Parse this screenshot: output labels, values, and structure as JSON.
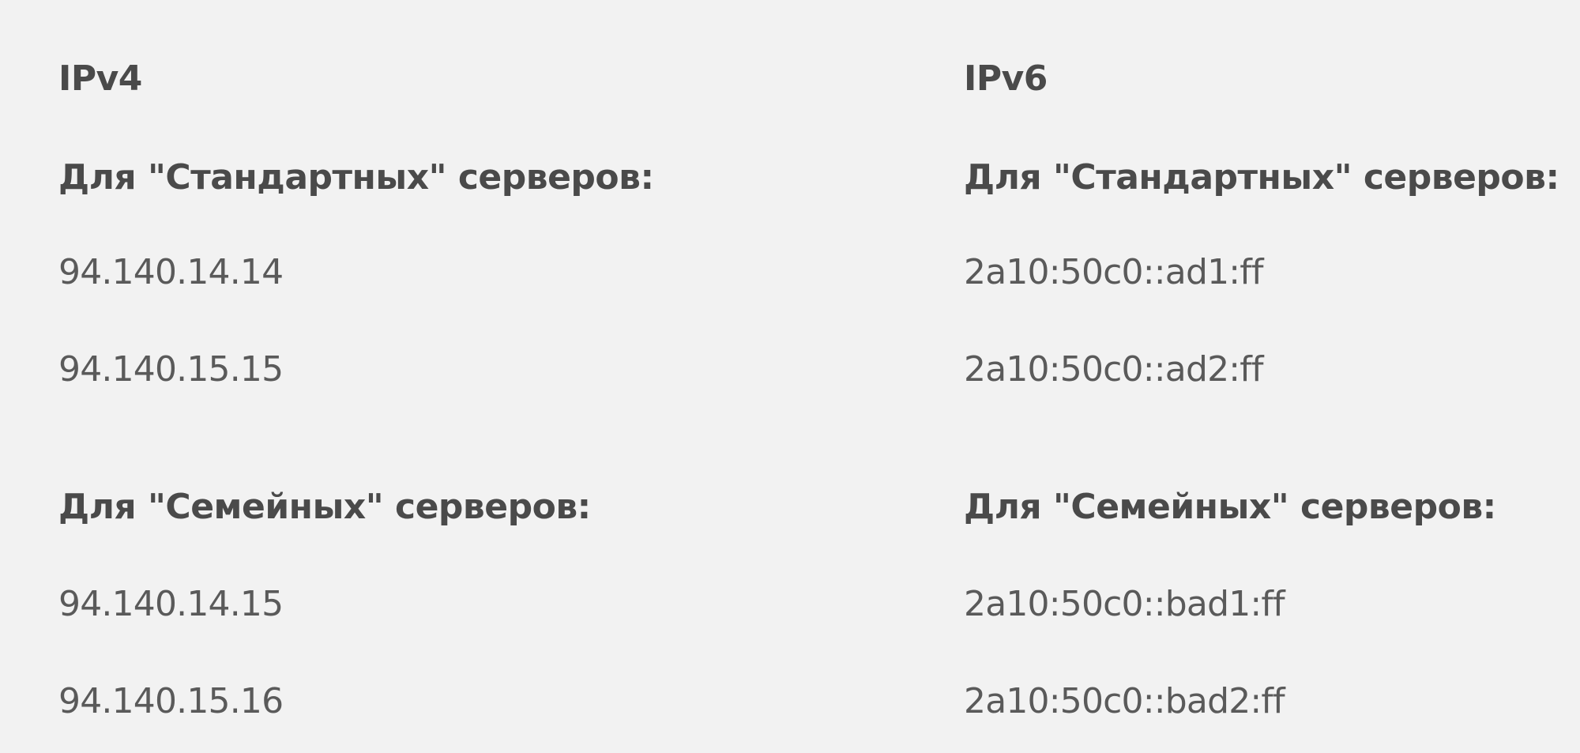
{
  "ipv4": {
    "title": "IPv4",
    "standard": {
      "label": "Для \"Стандартных\" серверов:",
      "addresses": [
        "94.140.14.14",
        "94.140.15.15"
      ]
    },
    "family": {
      "label": "Для \"Семейных\" серверов:",
      "addresses": [
        "94.140.14.15",
        "94.140.15.16"
      ]
    }
  },
  "ipv6": {
    "title": "IPv6",
    "standard": {
      "label": "Для \"Стандартных\" серверов:",
      "addresses": [
        "2a10:50c0::ad1:ff",
        "2a10:50c0::ad2:ff"
      ]
    },
    "family": {
      "label": "Для \"Семейных\" серверов:",
      "addresses": [
        "2a10:50c0::bad1:ff",
        "2a10:50c0::bad2:ff"
      ]
    }
  }
}
